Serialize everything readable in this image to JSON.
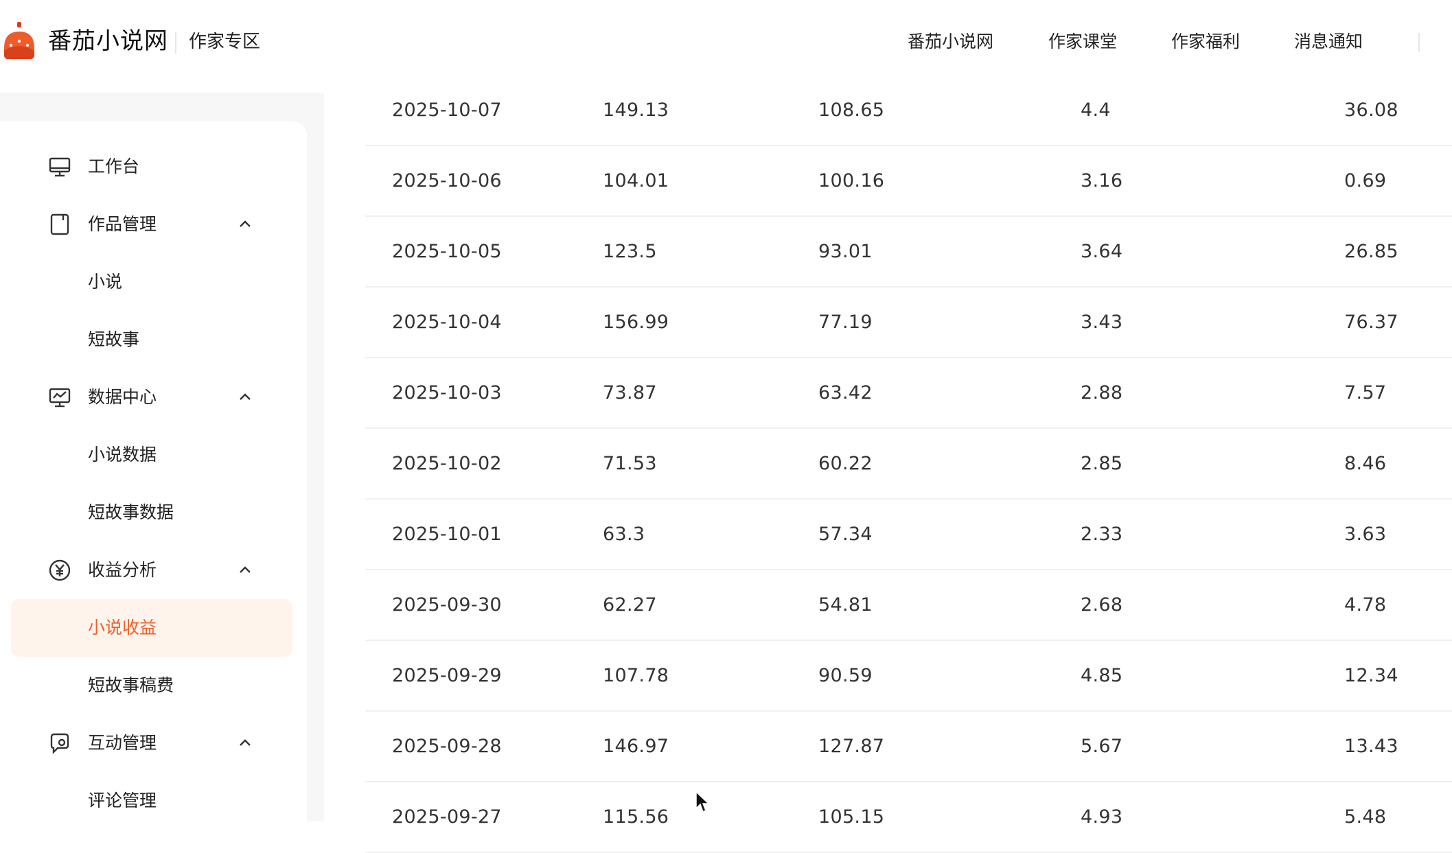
{
  "header": {
    "brand": "番茄小说网",
    "section": "作家专区",
    "nav": [
      "番茄小说网",
      "作家课堂",
      "作家福利",
      "消息通知"
    ]
  },
  "sidebar": {
    "items": [
      {
        "label": "工作台",
        "icon": "monitor-icon"
      },
      {
        "label": "作品管理",
        "icon": "book-icon",
        "expanded": true,
        "children": [
          "小说",
          "短故事"
        ]
      },
      {
        "label": "数据中心",
        "icon": "chart-icon",
        "expanded": true,
        "children": [
          "小说数据",
          "短故事数据"
        ]
      },
      {
        "label": "收益分析",
        "icon": "yuan-icon",
        "expanded": true,
        "children": [
          "小说收益",
          "短故事稿费"
        ]
      },
      {
        "label": "互动管理",
        "icon": "interaction-icon",
        "expanded": true,
        "children": [
          "评论管理"
        ]
      }
    ],
    "active": "小说收益"
  },
  "table": {
    "rows": [
      [
        "2025-10-07",
        "149.13",
        "108.65",
        "4.4",
        "36.08"
      ],
      [
        "2025-10-06",
        "104.01",
        "100.16",
        "3.16",
        "0.69"
      ],
      [
        "2025-10-05",
        "123.5",
        "93.01",
        "3.64",
        "26.85"
      ],
      [
        "2025-10-04",
        "156.99",
        "77.19",
        "3.43",
        "76.37"
      ],
      [
        "2025-10-03",
        "73.87",
        "63.42",
        "2.88",
        "7.57"
      ],
      [
        "2025-10-02",
        "71.53",
        "60.22",
        "2.85",
        "8.46"
      ],
      [
        "2025-10-01",
        "63.3",
        "57.34",
        "2.33",
        "3.63"
      ],
      [
        "2025-09-30",
        "62.27",
        "54.81",
        "2.68",
        "4.78"
      ],
      [
        "2025-09-29",
        "107.78",
        "90.59",
        "4.85",
        "12.34"
      ],
      [
        "2025-09-28",
        "146.97",
        "127.87",
        "5.67",
        "13.43"
      ],
      [
        "2025-09-27",
        "115.56",
        "105.15",
        "4.93",
        "5.48"
      ]
    ]
  },
  "colors": {
    "accent": "#f0602a",
    "active_bg": "#fff4ec",
    "sidebar_bg": "#f7f7f8"
  }
}
